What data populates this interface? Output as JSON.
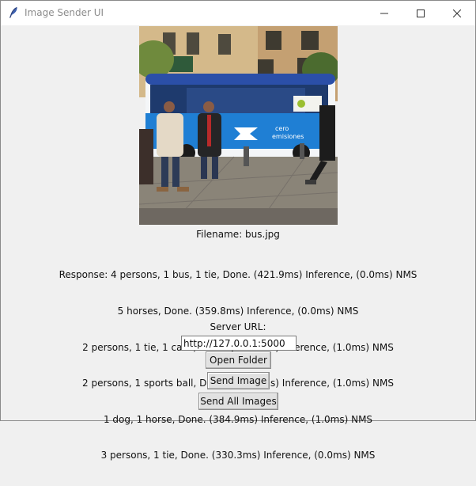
{
  "window": {
    "title": "Image Sender UI",
    "icon": "feather-icon",
    "controls": [
      "minimize-icon",
      "maximize-icon",
      "close-icon"
    ]
  },
  "image": {
    "description_icon": "bus-street-photo",
    "bus_text": [
      "cero",
      "emisiones"
    ]
  },
  "filename_line": "Filename: bus.jpg",
  "response_lines": [
    "Response: 4 persons, 1 bus, 1 tie, Done. (421.9ms) Inference, (0.0ms) NMS",
    "5 horses, Done. (359.8ms) Inference, (0.0ms) NMS",
    "2 persons, 1 tie, 1 cake, Done. (450.9ms) Inference, (1.0ms) NMS",
    "2 persons, 1 sports ball, Done. (399.5ms) Inference, (1.0ms) NMS",
    "1 dog, 1 horse, Done. (384.9ms) Inference, (1.0ms) NMS",
    "3 persons, 1 tie, Done. (330.3ms) Inference, (0.0ms) NMS"
  ],
  "server": {
    "label": "Server URL:",
    "url_value": "http://127.0.0.1:5000"
  },
  "buttons": {
    "open_folder": "Open Folder",
    "send_image": "Send Image",
    "send_all": "Send All Images"
  }
}
